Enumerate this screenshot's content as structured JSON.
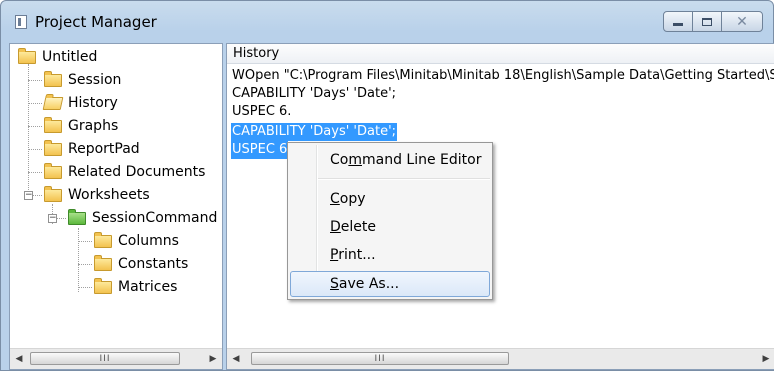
{
  "window": {
    "title": "Project Manager"
  },
  "caption_buttons": {
    "minimize": "minimize",
    "maximize": "maximize",
    "close": "✕"
  },
  "tree": {
    "root": "Untitled",
    "items": [
      {
        "label": "Session"
      },
      {
        "label": "History"
      },
      {
        "label": "Graphs"
      },
      {
        "label": "ReportPad"
      },
      {
        "label": "Related Documents"
      },
      {
        "label": "Worksheets"
      },
      {
        "label": "SessionCommand"
      },
      {
        "label": "Columns"
      },
      {
        "label": "Constants"
      },
      {
        "label": "Matrices"
      }
    ]
  },
  "history": {
    "header": "History",
    "lines": [
      "WOpen \"C:\\Program Files\\Minitab\\Minitab 18\\English\\Sample Data\\Getting Started\\Sessio",
      "CAPABILITY 'Days' 'Date';",
      "USPEC 6.",
      "CAPABILITY 'Days' 'Date';",
      "USPEC 6"
    ]
  },
  "scrollbars": {
    "thumb_grip": "III",
    "left_arrow": "◀",
    "right_arrow": "▶"
  },
  "context_menu": {
    "items": [
      {
        "pre": "Co",
        "acc": "m",
        "post": "mand Line Editor"
      },
      {
        "pre": "",
        "acc": "C",
        "post": "opy"
      },
      {
        "pre": "",
        "acc": "D",
        "post": "elete"
      },
      {
        "pre": "",
        "acc": "P",
        "post": "rint..."
      },
      {
        "pre": "",
        "acc": "S",
        "post": "ave As..."
      }
    ],
    "highlighted_item": "Save As..."
  }
}
